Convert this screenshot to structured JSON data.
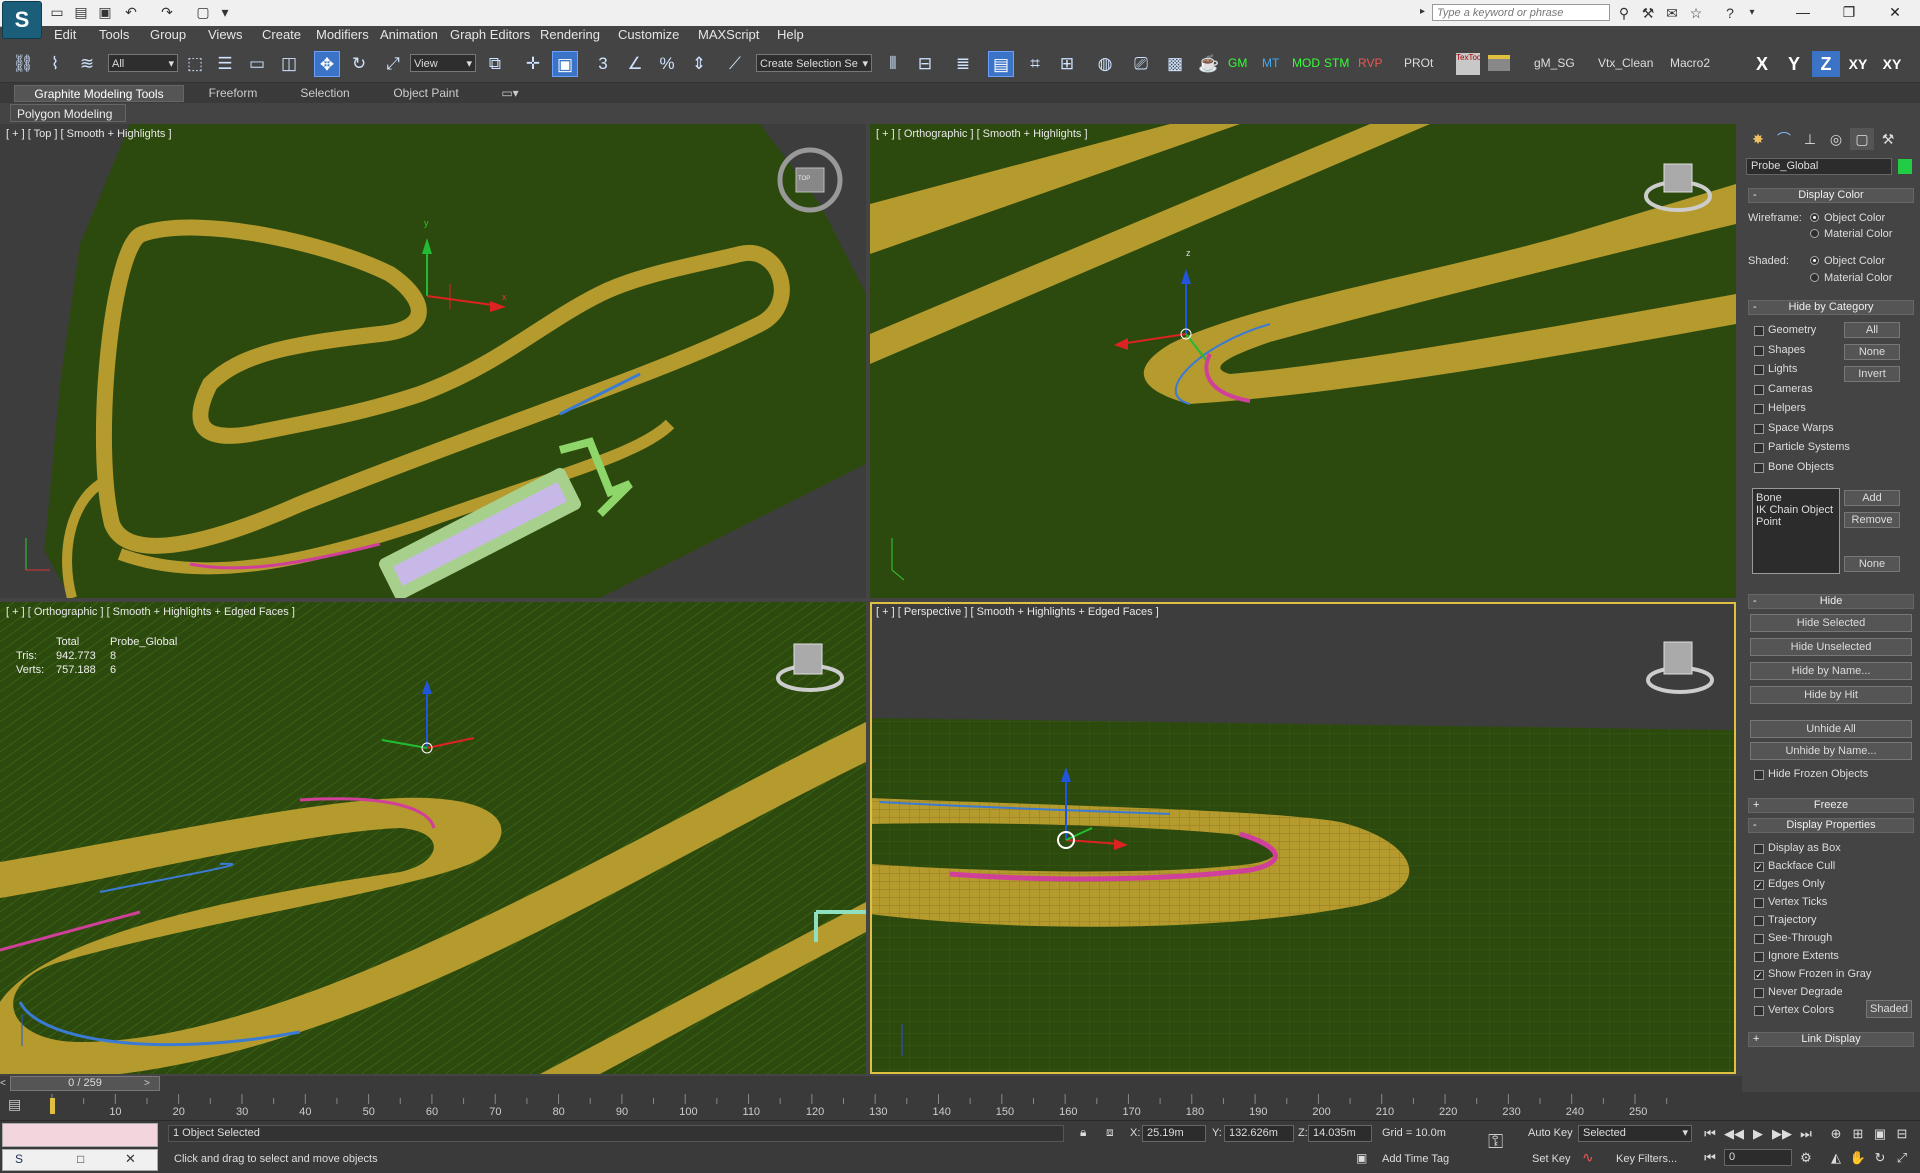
{
  "titlebar": {
    "logo": "S",
    "search_placeholder": "Type a keyword or phrase"
  },
  "menu": [
    "Edit",
    "Tools",
    "Group",
    "Views",
    "Create",
    "Modifiers",
    "Animation",
    "Graph Editors",
    "Rendering",
    "Customize",
    "MAXScript",
    "Help"
  ],
  "toolbar": {
    "selection_filter": "All",
    "ref_coord": "View",
    "named_selection": "Create Selection Se",
    "scripts": [
      "GM",
      "MT",
      "MOD",
      "STM",
      "RVP",
      "PROt",
      "gM_SG",
      "Vtx_Clean",
      "Macro2"
    ],
    "tex_tools_label": "TexTools",
    "axis": [
      "X",
      "Y",
      "Z",
      "XY",
      "XY"
    ]
  },
  "ribbon": {
    "tabs": [
      "Graphite Modeling Tools",
      "Freeform",
      "Selection",
      "Object Paint"
    ],
    "active_tab": 0,
    "sub_panel": "Polygon Modeling"
  },
  "viewports": {
    "top_left": {
      "label": "[ + ] [ Top ] [ Smooth + Highlights ]",
      "viewcube": "TOP"
    },
    "top_right": {
      "label": "[ + ] [ Orthographic ] [ Smooth + Highlights ]"
    },
    "bottom_left": {
      "label": "[ + ] [ Orthographic ] [ Smooth + Highlights + Edged Faces ]",
      "stats": {
        "header_total": "Total",
        "header_object": "Probe_Global",
        "tris_label": "Tris:",
        "tris_total": "942.773",
        "tris_object": "8",
        "verts_label": "Verts:",
        "verts_total": "757.188",
        "verts_object": "6"
      }
    },
    "bottom_right": {
      "label": "[ + ] [ Perspective ] [ Smooth + Highlights + Edged Faces ]"
    },
    "gizmo_z": "z",
    "gizmo_y": "y",
    "gizmo_x": "x"
  },
  "command_panel": {
    "object_name": "Probe_Global",
    "object_color": "#22cc44",
    "display_color": {
      "title": "Display Color",
      "wireframe_label": "Wireframe:",
      "shaded_label": "Shaded:",
      "opt_object": "Object Color",
      "opt_material": "Material Color"
    },
    "hide_by_category": {
      "title": "Hide by Category",
      "items": [
        "Geometry",
        "Shapes",
        "Lights",
        "Cameras",
        "Helpers",
        "Space Warps",
        "Particle Systems",
        "Bone Objects"
      ],
      "btn_all": "All",
      "btn_none": "None",
      "btn_invert": "Invert",
      "list": [
        "Bone",
        "IK Chain Object",
        "Point"
      ],
      "btn_add": "Add",
      "btn_remove": "Remove",
      "btn_none2": "None"
    },
    "hide": {
      "title": "Hide",
      "buttons": [
        "Hide Selected",
        "Hide Unselected",
        "Hide by Name...",
        "Hide by Hit",
        "Unhide All",
        "Unhide by Name..."
      ],
      "frozen": "Hide Frozen Objects"
    },
    "freeze_title": "Freeze",
    "display_properties": {
      "title": "Display Properties",
      "items": [
        {
          "label": "Display as Box",
          "checked": false
        },
        {
          "label": "Backface Cull",
          "checked": true
        },
        {
          "label": "Edges Only",
          "checked": true
        },
        {
          "label": "Vertex Ticks",
          "checked": false
        },
        {
          "label": "Trajectory",
          "checked": false
        },
        {
          "label": "See-Through",
          "checked": false
        },
        {
          "label": "Ignore Extents",
          "checked": false
        },
        {
          "label": "Show Frozen in Gray",
          "checked": true
        },
        {
          "label": "Never Degrade",
          "checked": false
        },
        {
          "label": "Vertex Colors",
          "checked": false
        }
      ],
      "shaded_btn": "Shaded"
    },
    "link_display_title": "Link Display"
  },
  "timeline": {
    "slider": "0 / 259",
    "ticks": [
      "10",
      "20",
      "30",
      "40",
      "50",
      "60",
      "70",
      "80",
      "90",
      "100",
      "110",
      "120",
      "130",
      "140",
      "150",
      "160",
      "170",
      "180",
      "190",
      "200",
      "210",
      "220",
      "230",
      "240",
      "250"
    ]
  },
  "status": {
    "selected": "1 Object Selected",
    "prompt": "Click and drag to select and move objects",
    "x_label": "X:",
    "x_val": "25.19m",
    "y_label": "Y:",
    "y_val": "132.626m",
    "z_label": "Z:",
    "z_val": "14.035m",
    "grid": "Grid = 10.0m",
    "add_time_tag": "Add Time Tag",
    "auto_key": "Auto Key",
    "set_key": "Set Key",
    "key_mode": "Selected",
    "key_filters": "Key Filters...",
    "frame": "0"
  },
  "colors": {
    "ground": "#2d4a0e",
    "road": "#b59a2e",
    "kerb_pink": "#d0409a",
    "kerb_blue": "#3a7bd5",
    "viewport_bg": "#3d3d3d",
    "selected_blue": "#3b74c7"
  }
}
